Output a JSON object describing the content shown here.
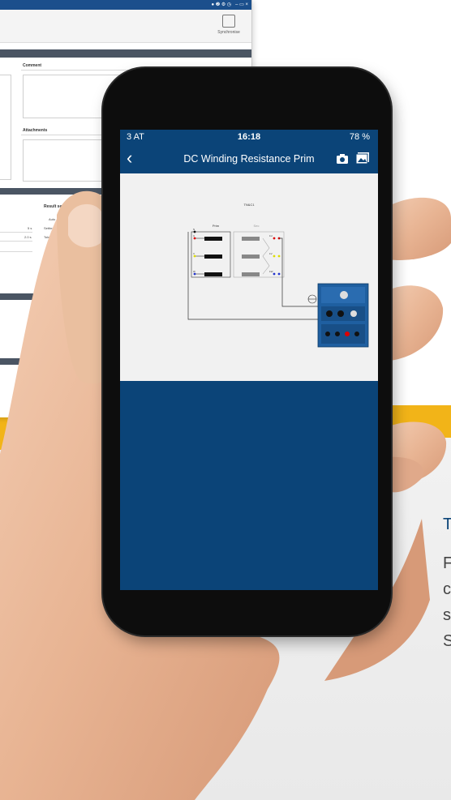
{
  "phone": {
    "status": {
      "carrier": "3 AT",
      "time": "16:18",
      "battery": "78 %"
    },
    "nav": {
      "back_glyph": "‹",
      "title": "DC Winding Resistance Prim",
      "camera_icon": "camera-icon",
      "photo_icon": "image-icon"
    },
    "diagram": {
      "title": "TN&C1",
      "prim_label": "Prim",
      "sec_label": "Sec",
      "terminals_prim": [
        "N",
        "U",
        "V",
        "W"
      ],
      "terminals_sec": [
        "1U",
        "1V",
        "1W"
      ]
    }
  },
  "desktop": {
    "sync_label": "Synchronise",
    "comment_label": "Comment",
    "attachments_label": "Attachments",
    "result_label": "Result set",
    "auto_label": "Auto",
    "setting_label": "Setting",
    "tolerance_label": "Toleran",
    "val1": "5 s",
    "val2": "2.0 s"
  },
  "right_text": {
    "title": "T",
    "lines": [
      "F",
      "c",
      "s",
      "S"
    ]
  },
  "colors": {
    "screen_blue": "#0b4478",
    "accent_yellow": "#f2b418",
    "panel_blue": "#1f5fa0"
  }
}
